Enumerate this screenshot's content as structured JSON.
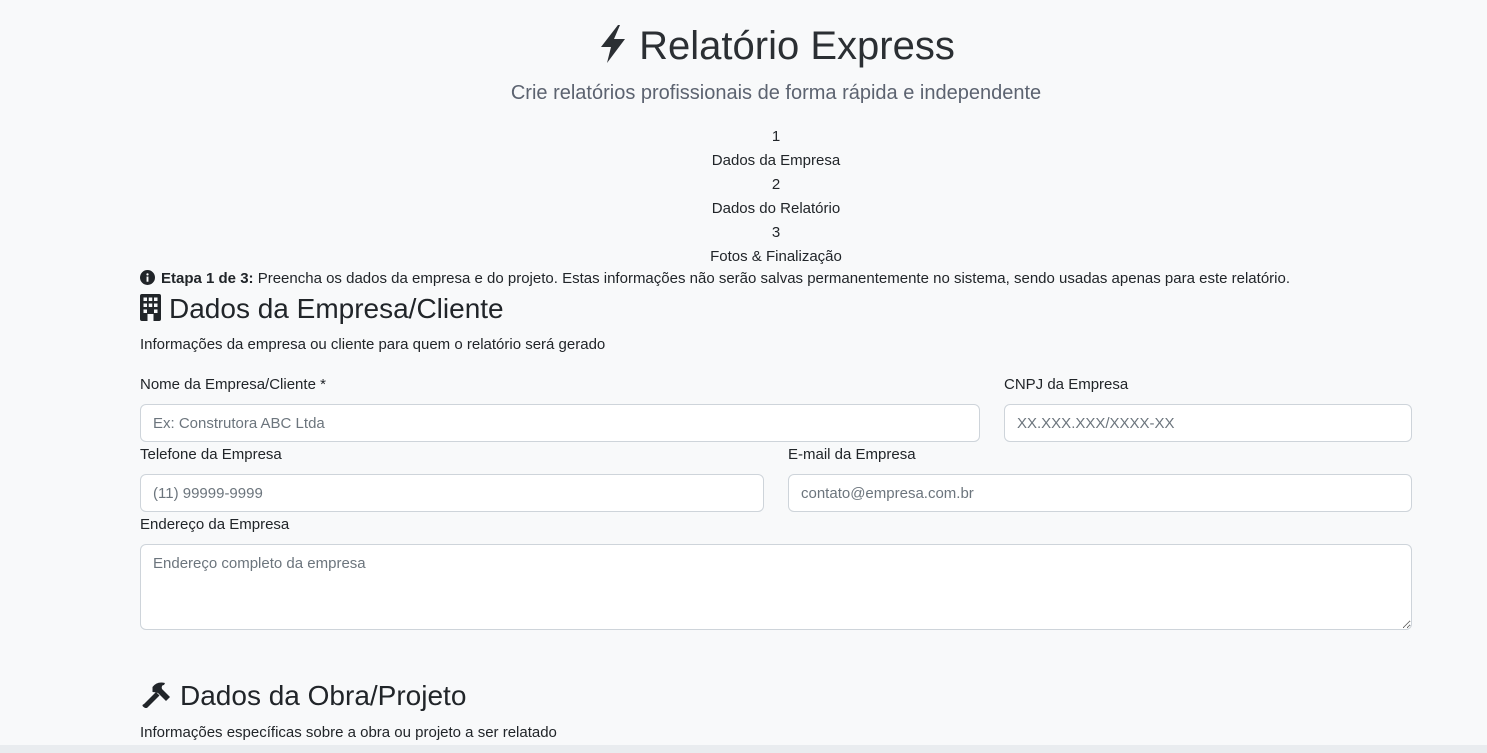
{
  "header": {
    "title": "Relatório Express",
    "subtitle": "Crie relatórios profissionais de forma rápida e independente"
  },
  "steps": [
    {
      "number": "1",
      "label": "Dados da Empresa"
    },
    {
      "number": "2",
      "label": "Dados do Relatório"
    },
    {
      "number": "3",
      "label": "Fotos & Finalização"
    }
  ],
  "alert": {
    "strong": "Etapa 1 de 3:",
    "text": " Preencha os dados da empresa e do projeto. Estas informações não serão salvas permanentemente no sistema, sendo usadas apenas para este relatório."
  },
  "company_section": {
    "title": "Dados da Empresa/Cliente",
    "description": "Informações da empresa ou cliente para quem o relatório será gerado",
    "fields": {
      "name": {
        "label": "Nome da Empresa/Cliente *",
        "placeholder": "Ex: Construtora ABC Ltda"
      },
      "cnpj": {
        "label": "CNPJ da Empresa",
        "placeholder": "XX.XXX.XXX/XXXX-XX"
      },
      "phone": {
        "label": "Telefone da Empresa",
        "placeholder": "(11) 99999-9999"
      },
      "email": {
        "label": "E-mail da Empresa",
        "placeholder": "contato@empresa.com.br"
      },
      "address": {
        "label": "Endereço da Empresa",
        "placeholder": "Endereço completo da empresa"
      }
    }
  },
  "project_section": {
    "title": "Dados da Obra/Projeto",
    "description": "Informações específicas sobre a obra ou projeto a ser relatado"
  }
}
